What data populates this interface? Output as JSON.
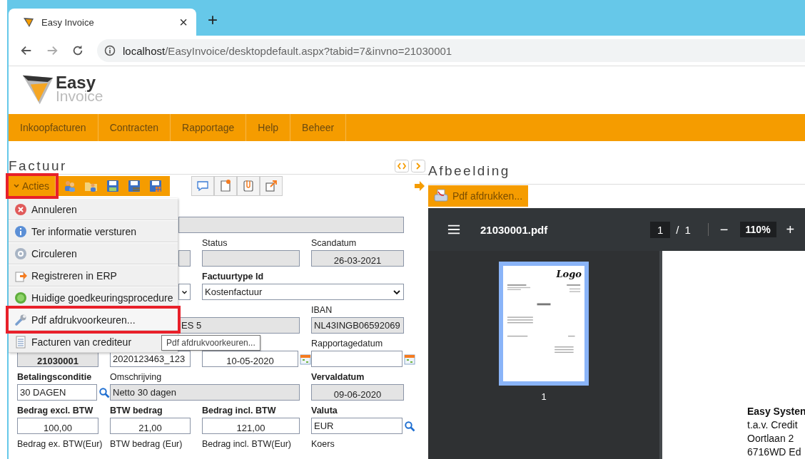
{
  "browser": {
    "tab": {
      "title": "Easy Invoice",
      "close": "×"
    },
    "new_tab": "+",
    "address": {
      "host": "localhost",
      "path": "/EasyInvoice/desktopdefault.aspx?tabid=7&invno=21030001"
    }
  },
  "logo": {
    "line1": "Easy",
    "line2": "Invoice"
  },
  "nav": [
    "Inkoopfacturen",
    "Contracten",
    "Rapportage",
    "Help",
    "Beheer"
  ],
  "left_panel": {
    "title": "Factuur",
    "actions_button": {
      "label": "Acties",
      "highlighted": true
    },
    "menu": [
      {
        "label": "Annuleren",
        "highlighted": false
      },
      {
        "label": "Ter informatie versturen",
        "highlighted": false
      },
      {
        "label": "Circuleren",
        "highlighted": false
      },
      {
        "label": "Registreren in ERP",
        "highlighted": false
      },
      {
        "label": "Huidige goedkeuringsprocedure",
        "highlighted": false
      },
      {
        "label": "Pdf afdrukvoorkeuren...",
        "highlighted": true
      },
      {
        "label": "Facturen van crediteur",
        "highlighted": false
      }
    ],
    "tooltip": "Pdf afdrukvoorkeuren...",
    "form": [
      {
        "kind": "readonly"
      },
      {
        "kind": "readonly"
      },
      {
        "label": "Status",
        "kind": "readonly"
      },
      {
        "label": "Scandatum",
        "kind": "readonly",
        "value": "26-03-2021",
        "right_aligned": true
      },
      {
        "kind": "select"
      },
      {
        "label": "Factuurtype Id",
        "required": true,
        "kind": "select",
        "value": "Kostenfactuur"
      },
      {
        "kind": "readonly",
        "value": "ES 5"
      },
      {
        "label": "IBAN",
        "kind": "readonly",
        "value": "NL43INGB06592069"
      },
      {
        "kind": "readonly",
        "value": "21030001",
        "right_aligned": true,
        "bold": true
      },
      {
        "kind": "text",
        "value": "2020123463_123"
      },
      {
        "kind": "text",
        "value": "10-05-2020",
        "right_aligned": true,
        "calendar": true
      },
      {
        "label": "Rapportagedatum",
        "kind": "text",
        "calendar": true
      },
      {
        "label": "Betalingsconditie",
        "required": true,
        "kind": "text",
        "value": "30 DAGEN",
        "search": true
      },
      {
        "label": "Omschrijving",
        "kind": "readonly",
        "value": "Netto 30 dagen"
      },
      {
        "label": "Vervaldatum",
        "required": true,
        "kind": "readonly",
        "value": "09-06-2020",
        "right_aligned": true
      },
      {
        "label": "Bedrag excl. BTW",
        "required": true,
        "kind": "text",
        "value": "100,00",
        "right_aligned": true
      },
      {
        "label": "BTW bedrag",
        "required": true,
        "kind": "text",
        "value": "21,00",
        "right_aligned": true
      },
      {
        "label": "Bedrag incl. BTW",
        "required": true,
        "kind": "text",
        "value": "121,00",
        "right_aligned": true
      },
      {
        "label": "Valuta",
        "required": true,
        "kind": "text",
        "value": "EUR",
        "search": true
      },
      {
        "label": "Bedrag ex. BTW(Eur)",
        "kind": "label"
      },
      {
        "label": "BTW bedrag (Eur)",
        "kind": "label"
      },
      {
        "label": "Bedrag incl. BTW(Eur)",
        "kind": "label"
      },
      {
        "label": "Koers",
        "kind": "label"
      }
    ]
  },
  "right_panel": {
    "title": "Afbeelding",
    "print_button": "Pdf afdrukken...",
    "pdf_viewer": {
      "filename": "21030001.pdf",
      "page": "1",
      "separator": "/",
      "total": "1",
      "zoom": "110%",
      "zoom_out": "−",
      "zoom_in": "+",
      "thumbnail_logo": "Logo",
      "thumbnail_label": "1",
      "page_lines": [
        {
          "text": "Easy Systen",
          "bold": true
        },
        {
          "text": "t.a.v. Credit",
          "bold": false
        },
        {
          "text": "Oortlaan 2",
          "bold": false
        },
        {
          "text": "6716WD Ed",
          "bold": false
        }
      ]
    }
  }
}
